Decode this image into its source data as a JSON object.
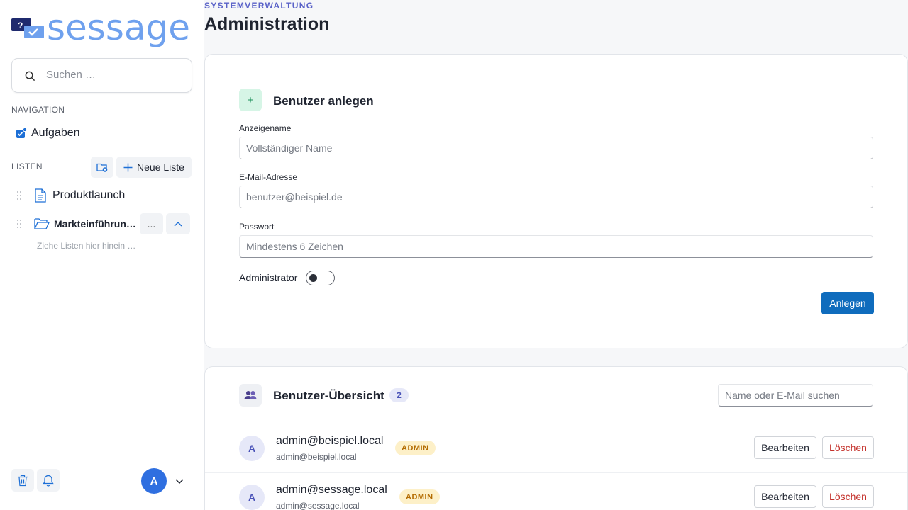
{
  "app": {
    "logo_text": "sessage"
  },
  "sidebar": {
    "search_placeholder": "Suchen …",
    "nav_label": "NAVIGATION",
    "nav_items": [
      {
        "label": "Aufgaben",
        "icon": "tasks-icon"
      }
    ],
    "lists_label": "LISTEN",
    "new_list_label": "Neue Liste",
    "lists": [
      {
        "label": "Produktlaunch",
        "icon": "document-icon"
      },
      {
        "label": "Markteinführun…",
        "icon": "folder-open-icon"
      }
    ],
    "more_label": "...",
    "drop_hint": "Ziehe Listen hier hinein …",
    "user_initial": "A"
  },
  "header": {
    "eyebrow": "SYSTEMVERWALTUNG",
    "title": "Administration"
  },
  "create_user": {
    "icon_glyph": "+",
    "title": "Benutzer anlegen",
    "display_name_label": "Anzeigename",
    "display_name_placeholder": "Vollständiger Name",
    "email_label": "E-Mail-Adresse",
    "email_placeholder": "benutzer@beispiel.de",
    "password_label": "Passwort",
    "password_placeholder": "Mindestens 6 Zeichen",
    "admin_label": "Administrator",
    "admin_enabled": false,
    "submit_label": "Anlegen"
  },
  "users_overview": {
    "title": "Benutzer-Übersicht",
    "count": "2",
    "search_placeholder": "Name oder E-Mail suchen",
    "edit_label": "Bearbeiten",
    "delete_label": "Löschen",
    "users": [
      {
        "initial": "A",
        "name": "admin@beispiel.local",
        "email": "admin@beispiel.local",
        "role": "ADMIN"
      },
      {
        "initial": "A",
        "name": "admin@sessage.local",
        "email": "admin@sessage.local",
        "role": "ADMIN"
      }
    ]
  },
  "colors": {
    "accent": "#0f6cbd",
    "brand": "#6fa1ee",
    "eyebrow": "#5a62c8",
    "danger": "#c4312b",
    "badge_bg": "#fdf0c8"
  }
}
